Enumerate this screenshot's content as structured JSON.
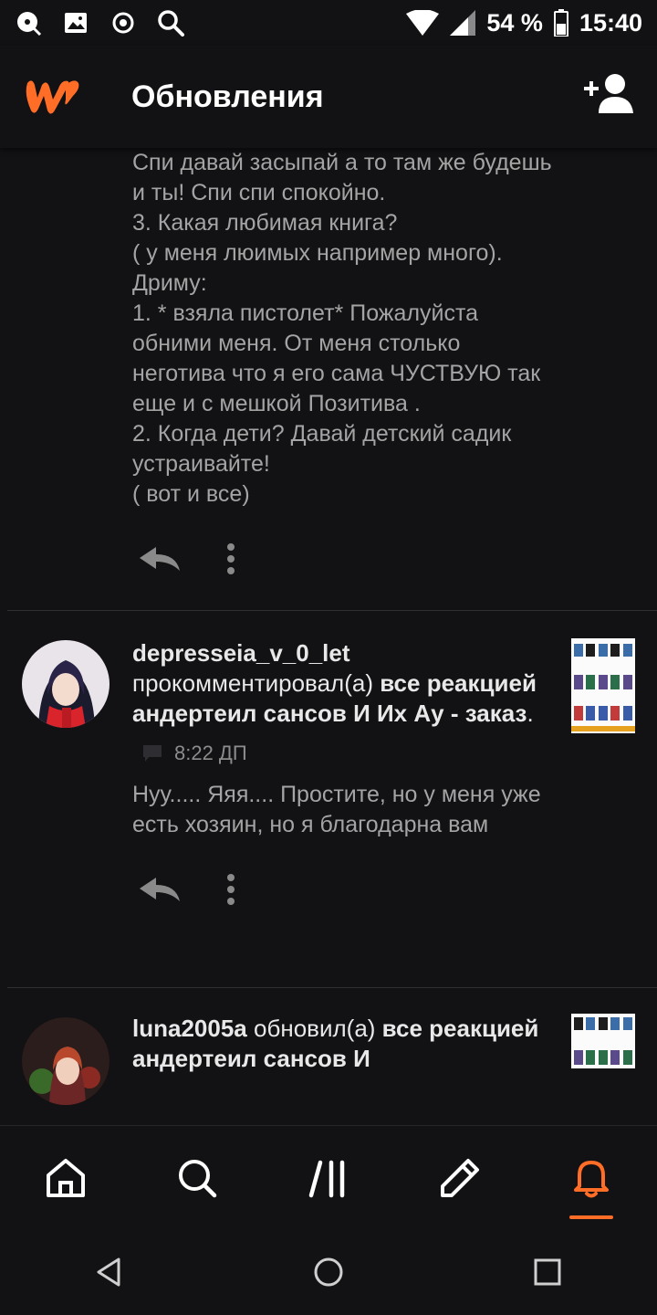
{
  "status_bar": {
    "icons_left": [
      "podcast-icon",
      "image-icon",
      "record-icon",
      "search-icon"
    ],
    "battery": "54 %",
    "time": "15:40"
  },
  "app_bar": {
    "title": "Обновления",
    "brand_color": "#ff6d27"
  },
  "feed": {
    "first_card": {
      "body": "Спи давай засыпай а то там же будешь и ты! Спи спи спокойно.\n3. Какая любимая книга?\n( у меня люимых например много).\nДриму:\n1. * взяла пистолет* Пожалуйста обними меня. От меня столько неготива что я его сама ЧУСТВУЮ так еще и с мешкой Позитива .\n2. Когда дети? Давай детский садик устраивайте!\n( вот и все)"
    },
    "second_card": {
      "username": "depresseia_v_0_let",
      "action": "прокомментировал(а)",
      "story": "все реакцией андертеил сансов И Их Ау - заказ",
      "time": "8:22 ДП",
      "body": "Нуу..... Яяя.... Простите, но у меня уже есть хозяин, но я благодарна вам"
    },
    "third_card": {
      "username": "luna2005a",
      "action": "обновил(а)",
      "story": "все реакцией андертеил сансов И"
    }
  },
  "bottom_nav": {
    "items": [
      "home",
      "search",
      "library",
      "write",
      "notifications"
    ],
    "active": "notifications"
  }
}
